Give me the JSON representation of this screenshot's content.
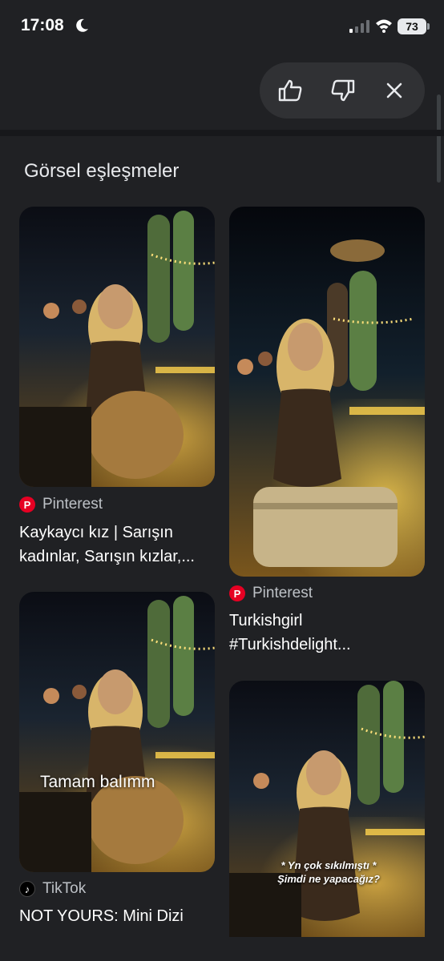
{
  "status_bar": {
    "time": "17:08",
    "battery": "73",
    "icons": [
      "moon-icon",
      "signal-icon",
      "wifi-icon",
      "battery-icon"
    ]
  },
  "feedback": {
    "icons": [
      "thumbs-up-icon",
      "thumbs-down-icon",
      "close-icon"
    ]
  },
  "section_title": "Görsel eşleşmeler",
  "results": [
    {
      "source": "Pinterest",
      "source_icon": "pinterest-icon",
      "title_line1": "Kaykaycı kız | Sarışın",
      "title_line2": "kadınlar, Sarışın kızlar,..."
    },
    {
      "source": "Pinterest",
      "source_icon": "pinterest-icon",
      "title_line1": "Turkishgirl",
      "title_line2": "#Turkishdelight..."
    },
    {
      "source": "TikTok",
      "source_icon": "tiktok-icon",
      "title_line1": "NOT YOURS: Mini Dizi",
      "caption": "Tamam balımm"
    },
    {
      "caption_line1": "* Yn çok sıkılmıştı *",
      "caption_line2": "Şimdi ne yapacağız?"
    }
  ],
  "colors": {
    "background": "#202124",
    "pill": "#303134",
    "pinterest": "#e60023",
    "text_secondary": "#bdc1c6"
  }
}
